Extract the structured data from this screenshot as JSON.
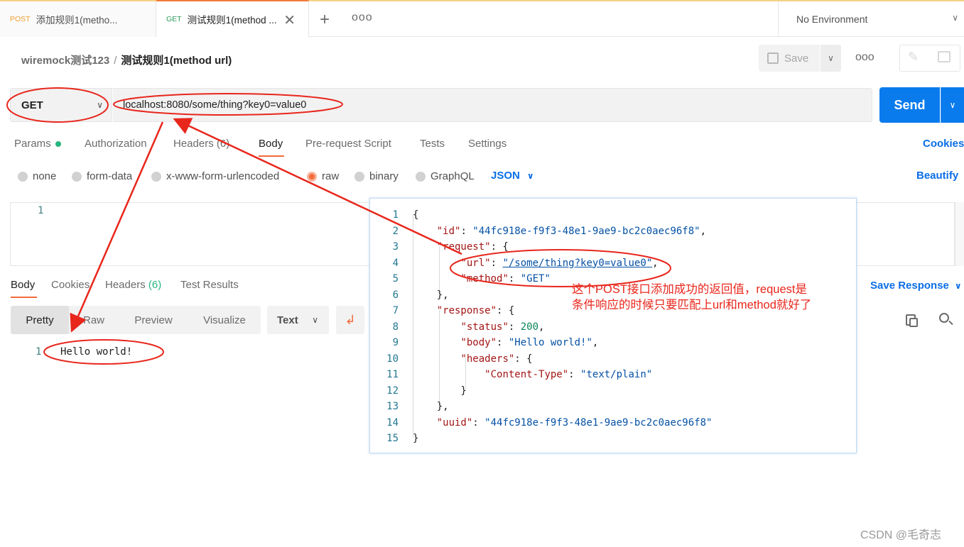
{
  "tabs": [
    {
      "method": "POST",
      "title": "添加规则1(metho..."
    },
    {
      "method": "GET",
      "title": "测试规则1(method ..."
    }
  ],
  "tab_close": "✕",
  "new_tab": "+",
  "more": "ooo",
  "environment": "No Environment",
  "breadcrumb": {
    "collection": "wiremock测试123",
    "separator": "/",
    "request": "测试规则1(method url)"
  },
  "toolbar": {
    "save_label": "Save"
  },
  "request": {
    "method": "GET",
    "url": "localhost:8080/some/thing?key0=value0",
    "send_label": "Send"
  },
  "request_tabs": [
    "Params",
    "Authorization",
    "Headers (6)",
    "Body",
    "Pre-request Script",
    "Tests",
    "Settings"
  ],
  "cookies_label": "Cookies",
  "body_types": [
    "none",
    "form-data",
    "x-www-form-urlencoded",
    "raw",
    "binary",
    "GraphQL"
  ],
  "body_format": "JSON",
  "beautify_label": "Beautify",
  "editor": {
    "line": "1"
  },
  "response_tabs": {
    "body": "Body",
    "cookies": "Cookies",
    "headers": "Headers",
    "headers_count": "(6)",
    "tests": "Test Results"
  },
  "save_response_label": "Save Response",
  "view_modes": [
    "Pretty",
    "Raw",
    "Preview",
    "Visualize"
  ],
  "text_format": "Text",
  "response_body": {
    "line": "1",
    "text": "Hello world!"
  },
  "popup_lines": [
    "1",
    "2",
    "3",
    "4",
    "5",
    "6",
    "7",
    "8",
    "9",
    "10",
    "11",
    "12",
    "13",
    "14",
    "15"
  ],
  "popup_json": {
    "id_key": "\"id\"",
    "id_val": "\"44fc918e-f9f3-48e1-9ae9-bc2c0aec96f8\"",
    "request_key": "\"request\"",
    "url_key": "\"url\"",
    "url_val": "\"/some/thing?key0=value0\"",
    "method_key": "\"method\"",
    "method_val": "\"GET\"",
    "response_key": "\"response\"",
    "status_key": "\"status\"",
    "status_val": "200",
    "body_key": "\"body\"",
    "body_val": "\"Hello world!\"",
    "headers_key": "\"headers\"",
    "ct_key": "\"Content-Type\"",
    "ct_val": "\"text/plain\"",
    "uuid_key": "\"uuid\"",
    "uuid_val": "\"44fc918e-f9f3-48e1-9ae9-bc2c0aec96f8\""
  },
  "annotation": {
    "line1": "这个POST接口添加成功的返回值，request是",
    "line2": "条件响应的时候只要匹配上url和method就好了",
    "color": "#e8261c"
  },
  "watermark": "CSDN @毛奇志",
  "colors": {
    "accent": "#f26b3a",
    "send": "#097bed",
    "link": "#0b6ee6",
    "success": "#26b47f"
  }
}
